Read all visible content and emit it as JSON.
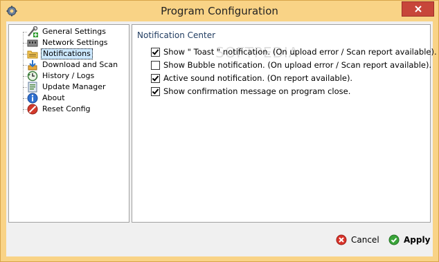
{
  "window": {
    "title": "Program Configuration"
  },
  "tree": {
    "items": [
      {
        "label": "General Settings",
        "icon": "tools-add-icon"
      },
      {
        "label": "Network Settings",
        "icon": "network-icon"
      },
      {
        "label": "Notifications",
        "icon": "notifications-folder-icon",
        "selected": true
      },
      {
        "label": "Download and Scan",
        "icon": "download-scan-icon"
      },
      {
        "label": "History / Logs",
        "icon": "history-clock-icon"
      },
      {
        "label": "Update Manager",
        "icon": "update-manager-icon"
      },
      {
        "label": "About",
        "icon": "info-icon"
      },
      {
        "label": "Reset Config",
        "icon": "reset-icon"
      }
    ]
  },
  "content": {
    "section_title": "Notification Center",
    "watermark": "SOFTPEDIA",
    "options": [
      {
        "label": "Show \" Toast \" notification. (On upload error / Scan report available).",
        "checked": true
      },
      {
        "label": "Show Bubble notification. (On upload error / Scan report available).",
        "checked": false
      },
      {
        "label": "Active sound notification. (On report available).",
        "checked": true
      },
      {
        "label": "Show confirmation message on program close.",
        "checked": true
      }
    ]
  },
  "footer": {
    "cancel_label": "Cancel",
    "apply_label": "Apply"
  },
  "colors": {
    "titlebar": "#f9d386",
    "close": "#c7463a",
    "cancel_icon": "#d9342b",
    "apply_icon": "#3aa53a"
  }
}
